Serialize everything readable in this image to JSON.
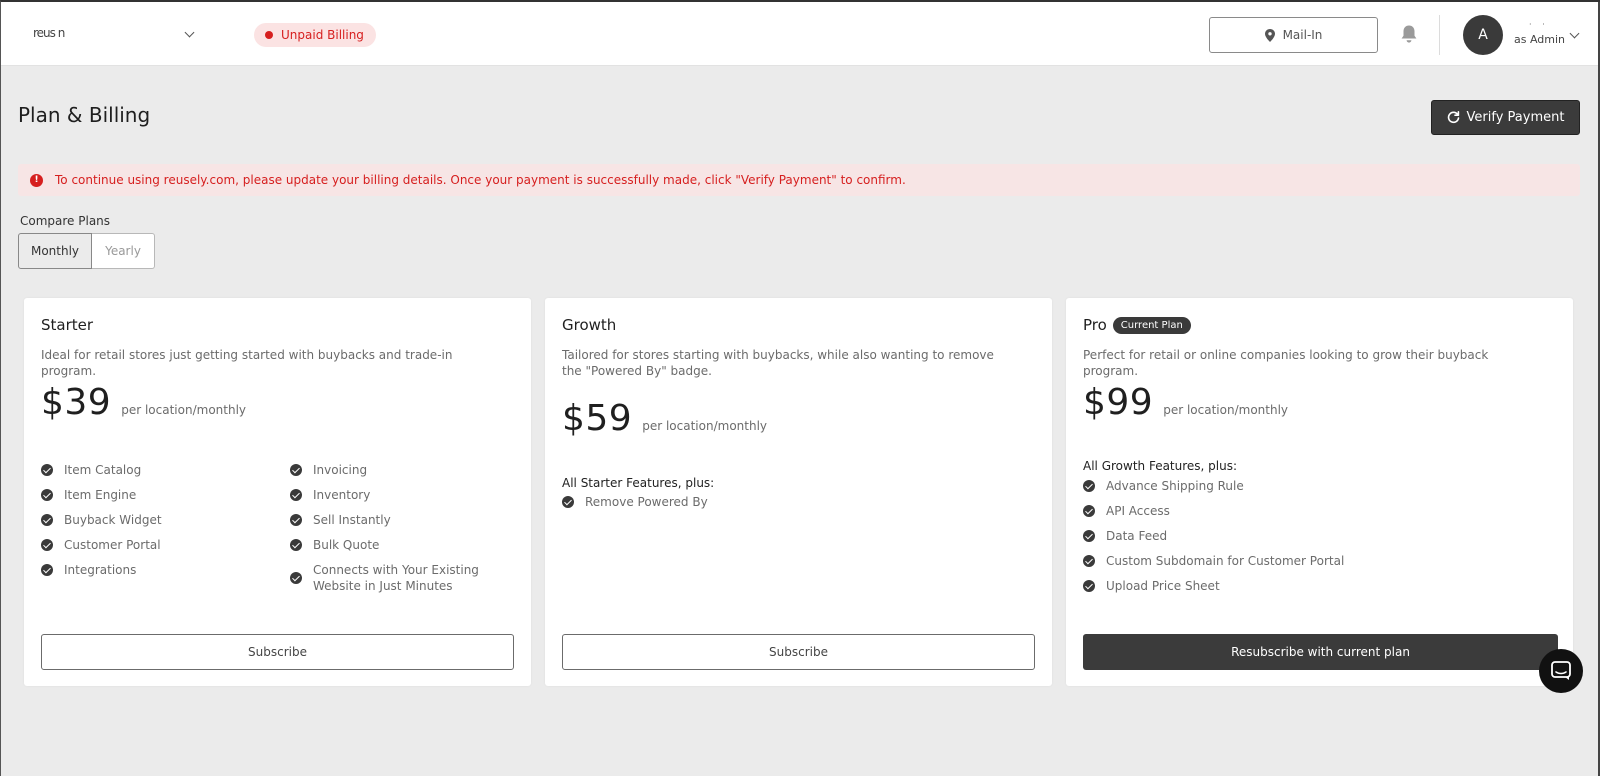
{
  "topbar": {
    "org_name": "reus   n",
    "billing_status": "Unpaid Billing",
    "location_button": "Mail-In",
    "avatar_initial": "A",
    "user_name": "· ·",
    "user_role": "as Admin"
  },
  "header": {
    "title": "Plan & Billing",
    "verify_button": "Verify Payment"
  },
  "alert": {
    "message": "To continue using reusely.com, please update your billing details. Once your payment is successfully made, click \"Verify Payment\" to confirm."
  },
  "compare": {
    "label": "Compare Plans",
    "options": [
      "Monthly",
      "Yearly"
    ],
    "selected": "Monthly"
  },
  "plans": [
    {
      "name": "Starter",
      "description": "Ideal for retail stores just getting started with buybacks and trade-in program.",
      "price": "$39",
      "price_unit": "per location/monthly",
      "features_col1": [
        "Item Catalog",
        "Item Engine",
        "Buyback Widget",
        "Customer Portal",
        "Integrations"
      ],
      "features_col2": [
        "Invoicing",
        "Inventory",
        "Sell Instantly",
        "Bulk Quote",
        "Connects with Your Existing Website in Just Minutes"
      ],
      "button": "Subscribe"
    },
    {
      "name": "Growth",
      "description": "Tailored for stores starting with buybacks, while also wanting to remove the \"Powered By\" badge.",
      "price": "$59",
      "price_unit": "per location/monthly",
      "features_heading": "All Starter Features, plus:",
      "features": [
        "Remove Powered By"
      ],
      "button": "Subscribe"
    },
    {
      "name": "Pro",
      "badge": "Current Plan",
      "description": "Perfect for retail or online companies looking to grow their buyback program.",
      "price": "$99",
      "price_unit": "per location/monthly",
      "features_heading": "All Growth Features, plus:",
      "features": [
        "Advance Shipping Rule",
        "API Access",
        "Data Feed",
        "Custom Subdomain for Customer Portal",
        "Upload Price Sheet"
      ],
      "button": "Resubscribe with current plan"
    }
  ],
  "colors": {
    "accent_dark": "#3b3b3b",
    "alert_red": "#d61f1f",
    "alert_bg": "#f7e5e5",
    "page_bg": "#ebebeb"
  },
  "icons": [
    "chevron-down-icon",
    "map-pin-icon",
    "bell-icon",
    "refresh-icon",
    "alert-info-icon",
    "check-circle-icon",
    "chat-icon"
  ]
}
